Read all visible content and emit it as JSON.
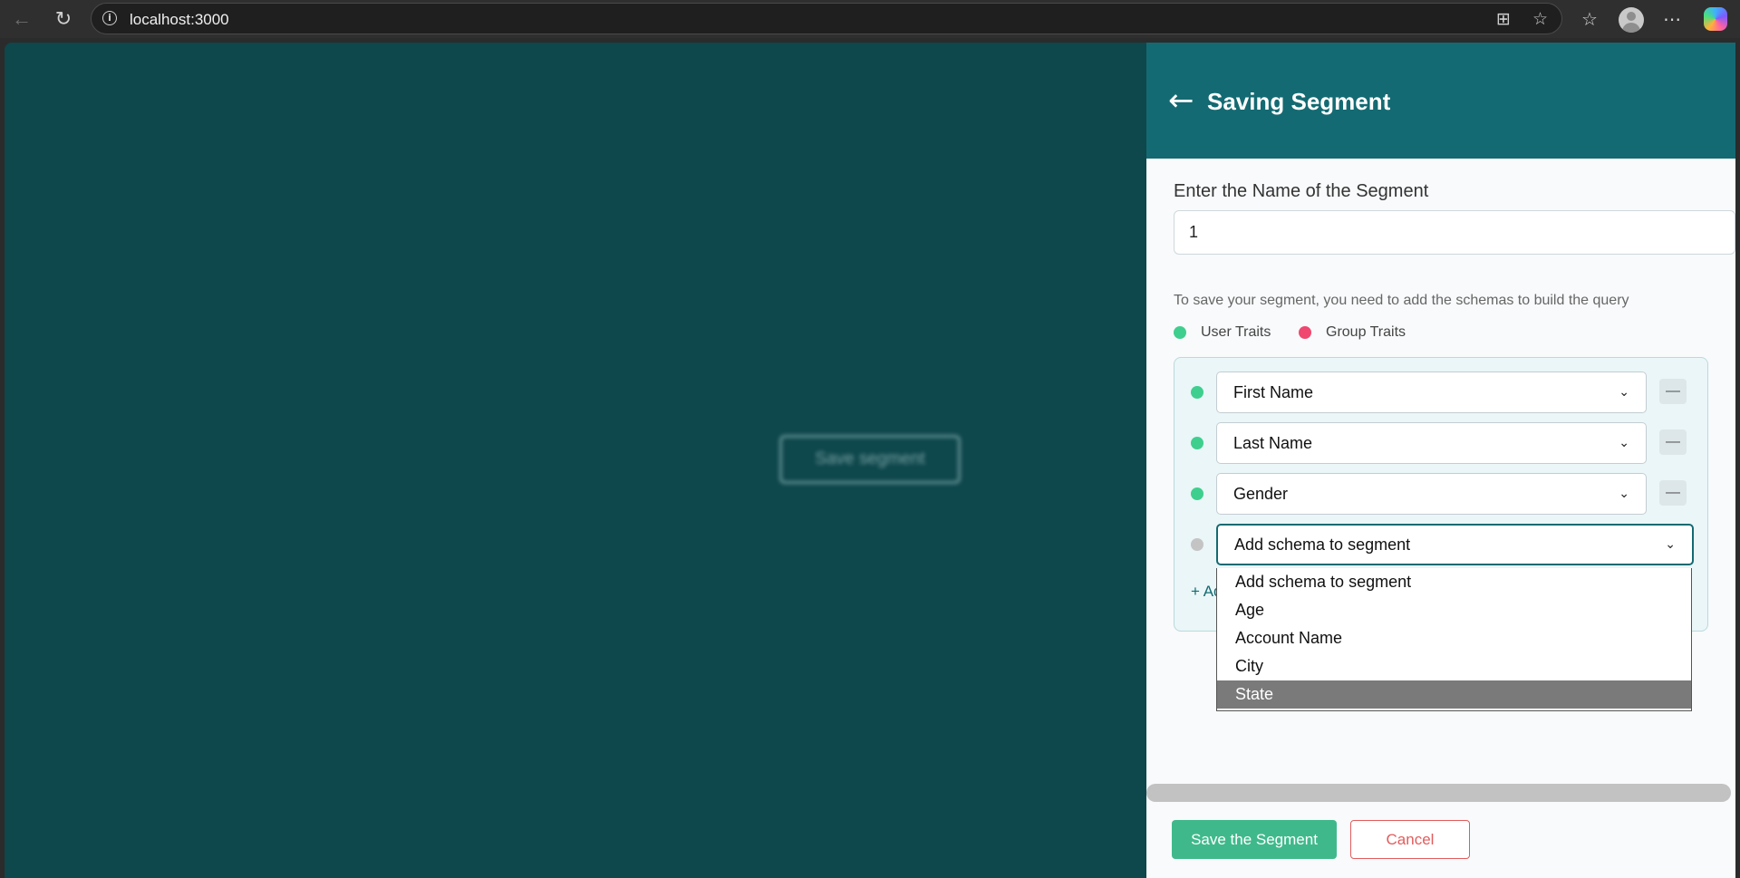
{
  "browser": {
    "url": "localhost:3000",
    "icons": {
      "back": "back-arrow-icon",
      "reload": "reload-icon",
      "info": "info-icon",
      "apps": "apps-icon",
      "favorite": "star-icon",
      "favorites_list": "favorites-icon",
      "profile": "profile-icon",
      "more": "more-icon",
      "copilot": "copilot-icon"
    }
  },
  "page": {
    "background_button_label": "Save segment"
  },
  "drawer": {
    "title": "Saving Segment",
    "back_glyph": "←",
    "name_label": "Enter the Name of the Segment",
    "name_value": "1",
    "hint": "To save your segment, you need to add the schemas to build the query",
    "legend": [
      {
        "label": "User Traits",
        "color": "#3ecf8e"
      },
      {
        "label": "Group Traits",
        "color": "#ef4770"
      }
    ],
    "schemas": [
      {
        "label": "First Name",
        "color": "#3ecf8e"
      },
      {
        "label": "Last Name",
        "color": "#3ecf8e"
      },
      {
        "label": "Gender",
        "color": "#3ecf8e"
      }
    ],
    "add_select": {
      "value": "Add schema to segment",
      "dot_color": "#c4c4c4"
    },
    "add_link": "+ Add new schema",
    "dropdown_options": [
      {
        "label": "Add schema to segment",
        "highlighted": false
      },
      {
        "label": "Age",
        "highlighted": false
      },
      {
        "label": "Account Name",
        "highlighted": false
      },
      {
        "label": "City",
        "highlighted": false
      },
      {
        "label": "State",
        "highlighted": true
      }
    ],
    "save_label": "Save the Segment",
    "cancel_label": "Cancel"
  },
  "colors": {
    "header": "#146a72",
    "page_bg": "#0e474c",
    "save": "#3fb98b",
    "cancel": "#e25c5c"
  }
}
